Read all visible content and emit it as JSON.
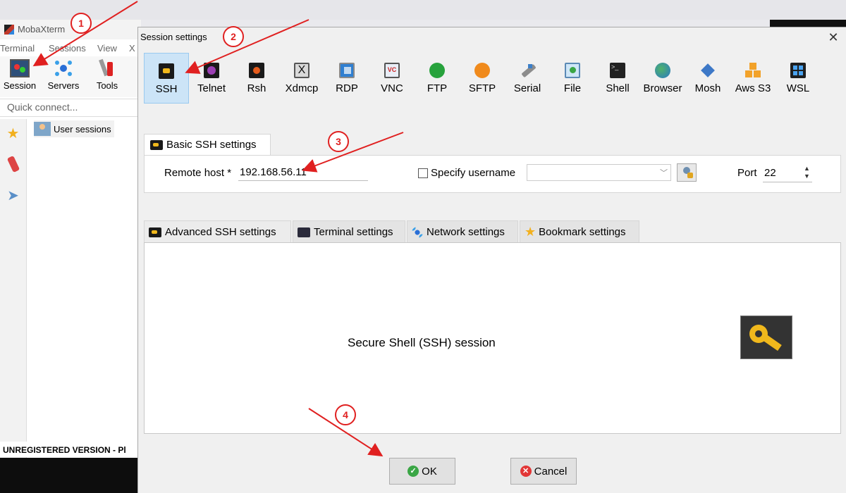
{
  "background_app": {
    "title": "MobaXterm",
    "menu": [
      "Terminal",
      "Sessions",
      "View",
      "X"
    ],
    "toolbar": [
      {
        "label": "Session",
        "icon": "session-monitor-icon"
      },
      {
        "label": "Servers",
        "icon": "servers-icon"
      },
      {
        "label": "Tools",
        "icon": "tools-icon"
      }
    ],
    "quick_connect_placeholder": "Quick connect...",
    "tree_item": "User sessions",
    "status": "UNREGISTERED VERSION  -  Pl"
  },
  "dialog": {
    "title": "Session settings",
    "close_glyph": "✕",
    "session_types": [
      {
        "label": "SSH",
        "active": true,
        "color": "#1a1a1a"
      },
      {
        "label": "Telnet",
        "active": false,
        "color": "#7a2e8c"
      },
      {
        "label": "Rsh",
        "active": false,
        "color": "#2b2b2b"
      },
      {
        "label": "Xdmcp",
        "active": false,
        "color": "#3a3a3a"
      },
      {
        "label": "RDP",
        "active": false,
        "color": "#2f7fd1"
      },
      {
        "label": "VNC",
        "active": false,
        "color": "#6f93c4"
      },
      {
        "label": "FTP",
        "active": false,
        "color": "#27a23c"
      },
      {
        "label": "SFTP",
        "active": false,
        "color": "#f08a1c"
      },
      {
        "label": "Serial",
        "active": false,
        "color": "#8c8c8c"
      },
      {
        "label": "File",
        "active": false,
        "color": "#4aa0d8"
      },
      {
        "label": "Shell",
        "active": false,
        "color": "#222222"
      },
      {
        "label": "Browser",
        "active": false,
        "color": "#2f9a5a"
      },
      {
        "label": "Mosh",
        "active": false,
        "color": "#3d78c7"
      },
      {
        "label": "Aws S3",
        "active": false,
        "color": "#f2a22a"
      },
      {
        "label": "WSL",
        "active": false,
        "color": "#1f5fa8"
      }
    ],
    "basic_tab_label": "Basic SSH settings",
    "remote_host_label": "Remote host *",
    "remote_host_value": "192.168.56.11",
    "specify_username_label": "Specify username",
    "username_value": "",
    "port_label": "Port",
    "port_value": "22",
    "advanced_tabs": [
      {
        "label": "Advanced SSH settings",
        "icon": "key-icon"
      },
      {
        "label": "Terminal settings",
        "icon": "terminal-icon"
      },
      {
        "label": "Network settings",
        "icon": "network-icon"
      },
      {
        "label": "Bookmark settings",
        "icon": "star-icon"
      }
    ],
    "content_text": "Secure Shell (SSH) session",
    "ok_label": "OK",
    "cancel_label": "Cancel"
  },
  "annotations": [
    "1",
    "2",
    "3",
    "4"
  ],
  "colors": {
    "annotation_red": "#e02020",
    "selected_bg": "#cce4f7",
    "key_yellow": "#f0b81c"
  }
}
